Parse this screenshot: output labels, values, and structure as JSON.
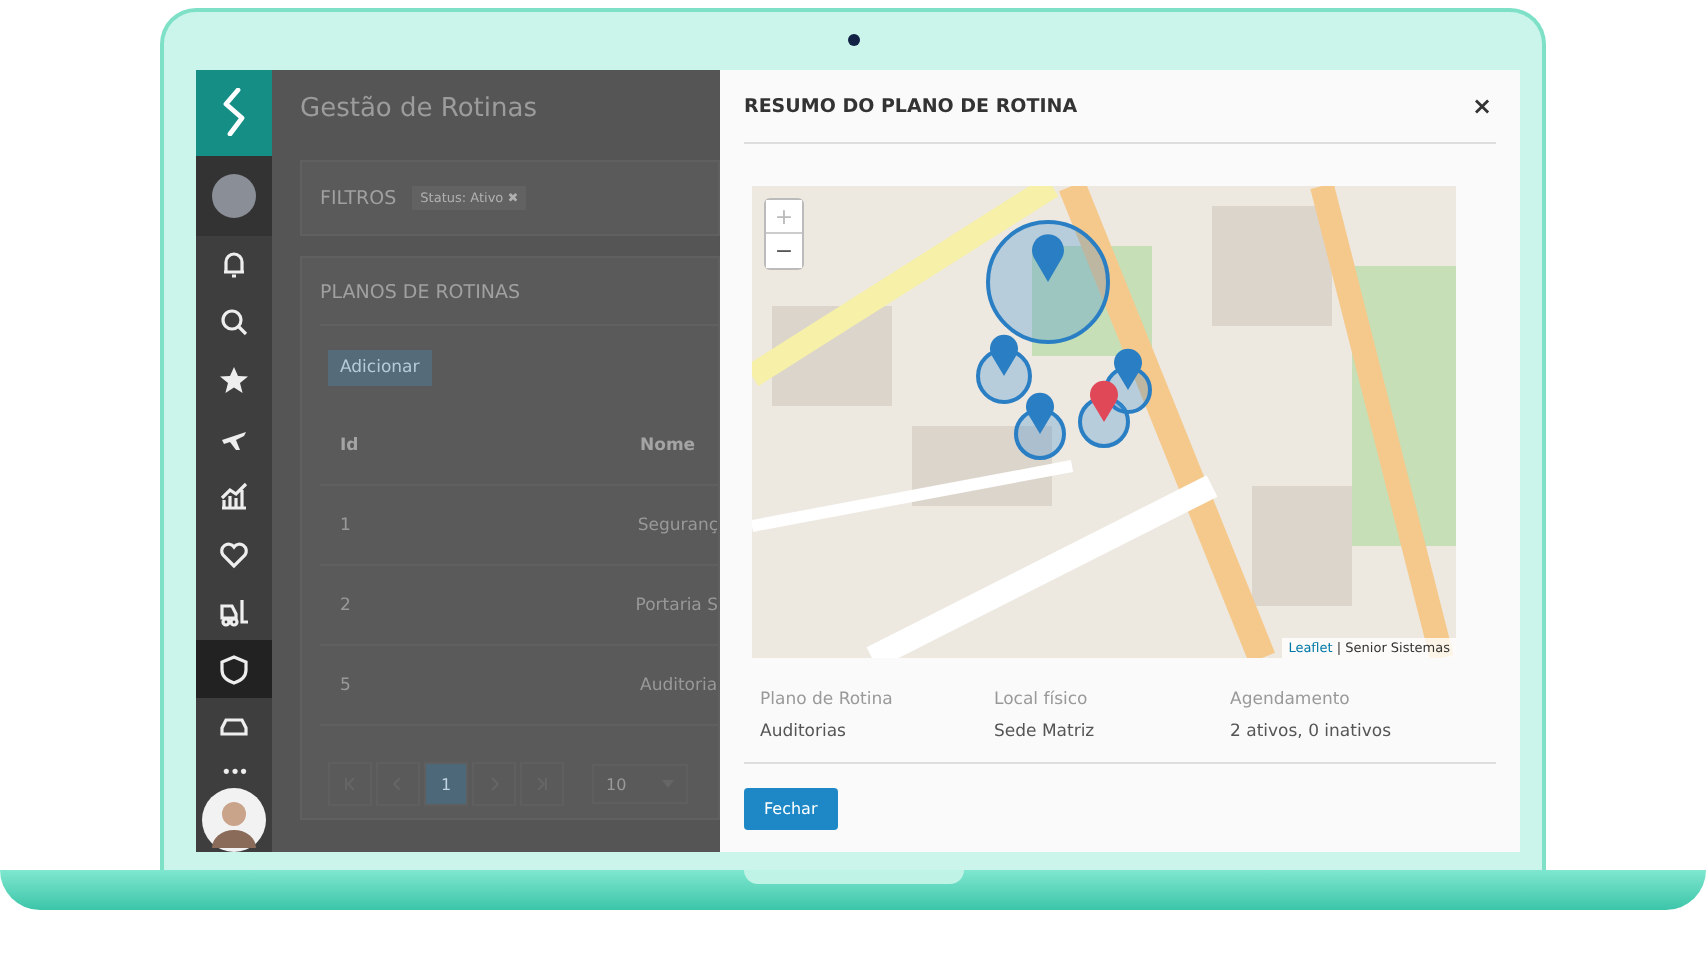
{
  "page": {
    "title": "Gestão de Rotinas"
  },
  "sidebar": {
    "items": [
      {
        "selected": false
      },
      {
        "selected": false
      },
      {
        "selected": false
      },
      {
        "selected": false
      },
      {
        "selected": false
      },
      {
        "selected": false
      },
      {
        "selected": false
      },
      {
        "selected": true
      },
      {
        "selected": false
      }
    ],
    "more_label": "•••"
  },
  "filters": {
    "title": "FILTROS",
    "chips": [
      "Status: Ativo ✖"
    ]
  },
  "plans": {
    "title": "PLANOS DE ROTINAS",
    "add_button": "Adicionar",
    "columns": [
      "Id",
      "Nome"
    ],
    "rows": [
      [
        "1",
        "Seguranç"
      ],
      [
        "2",
        "Portaria S"
      ],
      [
        "5",
        "Auditoria"
      ]
    ],
    "pager": {
      "pages": [
        {
          "label": "1",
          "selected": true
        }
      ],
      "page_size": "10"
    }
  },
  "modal": {
    "title": "RESUMO DO PLANO DE ROTINA",
    "close": "×",
    "map": {
      "zoom_in": "+",
      "zoom_out": "−",
      "attribution_link": "Leaflet",
      "attribution": "| Senior Sistemas"
    },
    "details": [
      {
        "label": "Plano de Rotina",
        "value": "Auditorias"
      },
      {
        "label": "Local físico",
        "value": "Sede Matriz"
      },
      {
        "label": "Agendamento",
        "value": "2 ativos, 0 inativos"
      }
    ],
    "button": "Fechar"
  }
}
